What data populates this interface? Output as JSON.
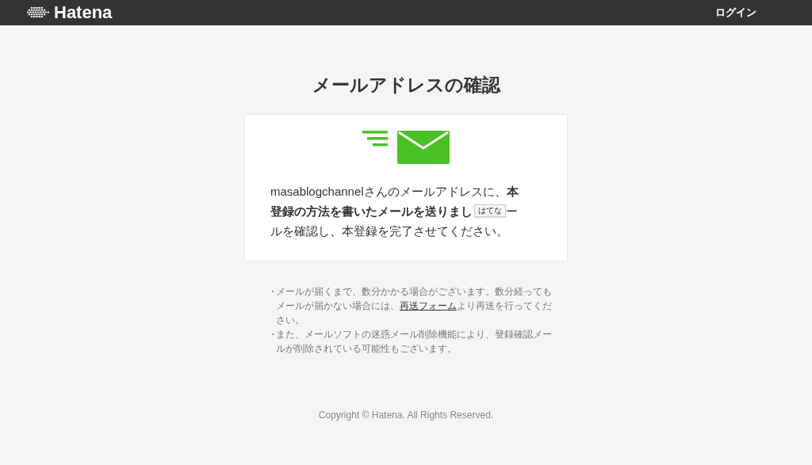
{
  "header": {
    "logo_text": "Hatena",
    "login": "ログイン"
  },
  "title": "メールアドレスの確認",
  "card": {
    "line_1": "masablogchannelさんのメールアドレスに、**本**",
    "line_2": "**登録の方法を書いたメールを送りまし**",
    "tooltip": "はてな",
    "line_2_end": "ー",
    "line_3": "ルを確認し、本登録を完了させてください。"
  },
  "notes": [
    {
      "bullet": "・",
      "before": "メールが届くまで、数分かかる場合がございます。数分経ってもメールが届かない場合には、",
      "link": "再送フォーム",
      "after": "より再送を行ってください。"
    },
    {
      "bullet": "・",
      "before": "また、メールソフトの迷惑メール削除機能により、登録確認メールが削除されている可能性もございます。"
    }
  ],
  "footer": "Copyright © Hatena. All Rights Reserved."
}
